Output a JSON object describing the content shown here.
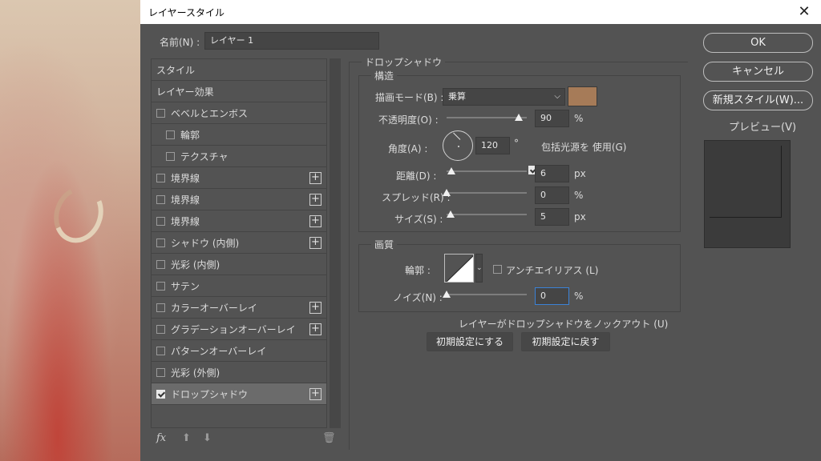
{
  "window": {
    "title": "レイヤースタイル"
  },
  "name_field": {
    "label": "名前(N) :",
    "value": "レイヤー 1"
  },
  "style_list": [
    {
      "label": "スタイル",
      "checkbox": false,
      "checked": false,
      "plus": false,
      "indent": false,
      "selected": false
    },
    {
      "label": "レイヤー効果",
      "checkbox": false,
      "checked": false,
      "plus": false,
      "indent": false,
      "selected": false
    },
    {
      "label": "ベベルとエンボス",
      "checkbox": true,
      "checked": false,
      "plus": false,
      "indent": false,
      "selected": false
    },
    {
      "label": "輪郭",
      "checkbox": true,
      "checked": false,
      "plus": false,
      "indent": true,
      "selected": false
    },
    {
      "label": "テクスチャ",
      "checkbox": true,
      "checked": false,
      "plus": false,
      "indent": true,
      "selected": false
    },
    {
      "label": "境界線",
      "checkbox": true,
      "checked": false,
      "plus": true,
      "indent": false,
      "selected": false
    },
    {
      "label": "境界線",
      "checkbox": true,
      "checked": false,
      "plus": true,
      "indent": false,
      "selected": false
    },
    {
      "label": "境界線",
      "checkbox": true,
      "checked": false,
      "plus": true,
      "indent": false,
      "selected": false
    },
    {
      "label": "シャドウ (内側)",
      "checkbox": true,
      "checked": false,
      "plus": true,
      "indent": false,
      "selected": false
    },
    {
      "label": "光彩 (内側)",
      "checkbox": true,
      "checked": false,
      "plus": false,
      "indent": false,
      "selected": false
    },
    {
      "label": "サテン",
      "checkbox": true,
      "checked": false,
      "plus": false,
      "indent": false,
      "selected": false
    },
    {
      "label": "カラーオーバーレイ",
      "checkbox": true,
      "checked": false,
      "plus": true,
      "indent": false,
      "selected": false
    },
    {
      "label": "グラデーションオーバーレイ",
      "checkbox": true,
      "checked": false,
      "plus": true,
      "indent": false,
      "selected": false
    },
    {
      "label": "パターンオーバーレイ",
      "checkbox": true,
      "checked": false,
      "plus": false,
      "indent": false,
      "selected": false
    },
    {
      "label": "光彩 (外側)",
      "checkbox": true,
      "checked": false,
      "plus": false,
      "indent": false,
      "selected": false
    },
    {
      "label": "ドロップシャドウ",
      "checkbox": true,
      "checked": true,
      "plus": true,
      "indent": false,
      "selected": true
    }
  ],
  "footer": {
    "fx": "fx"
  },
  "drop_shadow": {
    "section_title": "ドロップシャドウ",
    "structure_title": "構造",
    "blend_mode": {
      "label": "描画モード(B) :",
      "value": "乗算"
    },
    "shadow_color": "#a67b58",
    "opacity": {
      "label": "不透明度(O) :",
      "value": "90",
      "unit": "%",
      "level": 0.9
    },
    "angle": {
      "label": "角度(A) :",
      "value": "120",
      "unit": "°",
      "global_light_label": "包括光源を 使用(G)",
      "global_light_checked": true
    },
    "distance": {
      "label": "距離(D) :",
      "value": "6",
      "unit": "px",
      "level": 0.06
    },
    "spread": {
      "label": "スプレッド(R) :",
      "value": "0",
      "unit": "%",
      "level": 0.0
    },
    "size": {
      "label": "サイズ(S) :",
      "value": "5",
      "unit": "px",
      "level": 0.05
    },
    "quality_title": "画質",
    "contour": {
      "label": "輪郭 :",
      "antialias_label": "アンチエイリアス (L)",
      "antialias_checked": false
    },
    "noise": {
      "label": "ノイズ(N) :",
      "value": "0",
      "unit": "%",
      "level": 0.0
    },
    "knockout": {
      "label": "レイヤーがドロップシャドウをノックアウト (U)",
      "checked": true
    },
    "make_default": "初期設定にする",
    "reset_default": "初期設定に戻す"
  },
  "buttons": {
    "ok": "OK",
    "cancel": "キャンセル",
    "new_style": "新規スタイル(W)..."
  },
  "preview": {
    "label": "プレビュー(V)",
    "checked": true
  }
}
